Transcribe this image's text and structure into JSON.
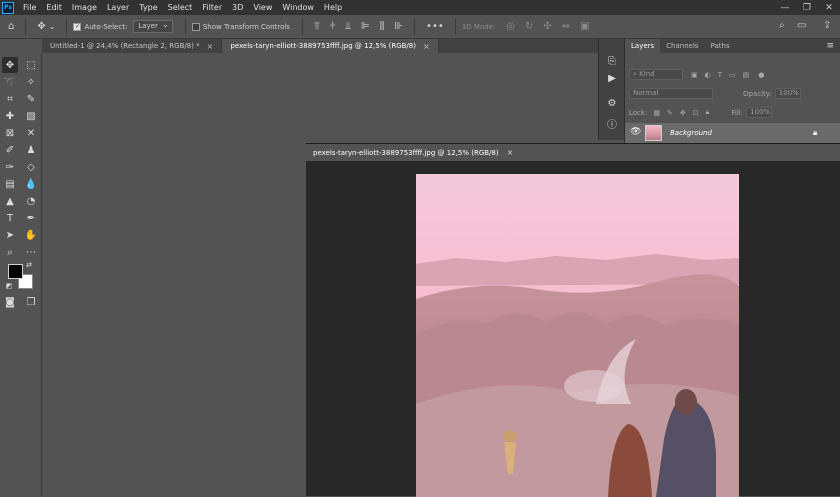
{
  "menubar": {
    "logo": "Ps",
    "items": [
      "File",
      "Edit",
      "Image",
      "Layer",
      "Type",
      "Select",
      "Filter",
      "3D",
      "View",
      "Window",
      "Help"
    ],
    "controls": [
      "—",
      "❐",
      "✕"
    ]
  },
  "options": {
    "auto_select_label": "Auto-Select:",
    "auto_select_value": "Layer",
    "show_transform_label": "Show Transform Controls",
    "mode_3d_label": "3D Mode:",
    "more": "•••"
  },
  "tabs": [
    {
      "label": "Untitled-1 @ 24,4% (Rectangle 2, RGB/8) *",
      "close": "×"
    },
    {
      "label": "pexels-taryn-elliott-3889753ffff.jpg @ 12,5% (RGB/8)",
      "close": "×"
    }
  ],
  "floating_window": {
    "title": "pexels-taryn-elliott-3889753ffff.jpg @ 12,5% (RGB/8)",
    "close": "×"
  },
  "layers_panel": {
    "tabs": [
      "Layers",
      "Channels",
      "Paths"
    ],
    "kind_label": "Kind",
    "blend_mode": "Normal",
    "opacity_label": "Opacity:",
    "opacity_value": "100%",
    "lock_label": "Lock:",
    "fill_label": "Fill:",
    "fill_value": "100%",
    "layer_name": "Background"
  },
  "colors": {
    "accent": "#31a8ff",
    "foreground": "#000000",
    "background": "#ffffff"
  }
}
